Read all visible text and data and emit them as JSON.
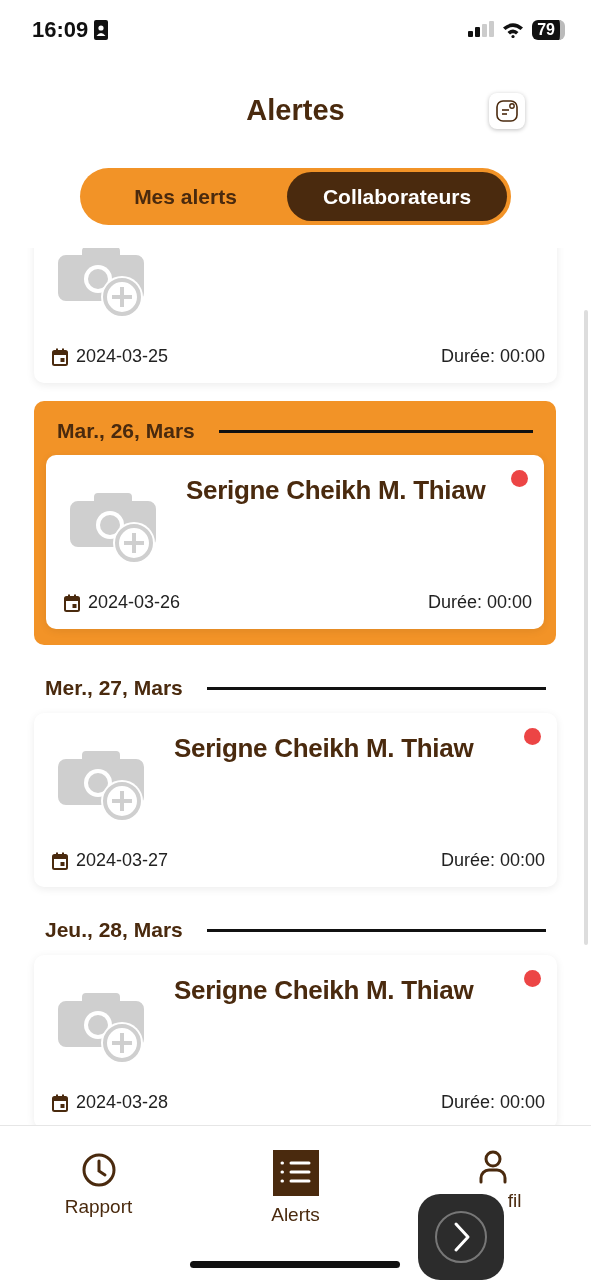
{
  "status_bar": {
    "time": "16:09",
    "battery": "79"
  },
  "header": {
    "title": "Alertes"
  },
  "tabs": [
    {
      "label": "Mes alerts",
      "selected": false
    },
    {
      "label": "Collaborateurs",
      "selected": true
    }
  ],
  "groups": [
    {
      "highlighted": false,
      "card": {
        "date": "2024-03-25",
        "duration": "Durée: 00:00"
      }
    },
    {
      "day": "Mar., 26, Mars",
      "highlighted": true,
      "card": {
        "name": "Serigne Cheikh M. Thiaw",
        "date": "2024-03-26",
        "duration": "Durée: 00:00",
        "unread": true
      }
    },
    {
      "day": "Mer., 27, Mars",
      "highlighted": false,
      "card": {
        "name": "Serigne Cheikh M. Thiaw",
        "date": "2024-03-27",
        "duration": "Durée: 00:00",
        "unread": true
      }
    },
    {
      "day": "Jeu., 28, Mars",
      "highlighted": false,
      "card": {
        "name": "Serigne Cheikh M. Thiaw",
        "date": "2024-03-28",
        "duration": "Durée: 00:00",
        "unread": true
      }
    }
  ],
  "nav": [
    {
      "kind": "clock",
      "label": "Rapport",
      "selected": false
    },
    {
      "kind": "list",
      "label": "Alerts",
      "selected": true
    },
    {
      "kind": "person",
      "label": "fil",
      "selected": false
    }
  ]
}
